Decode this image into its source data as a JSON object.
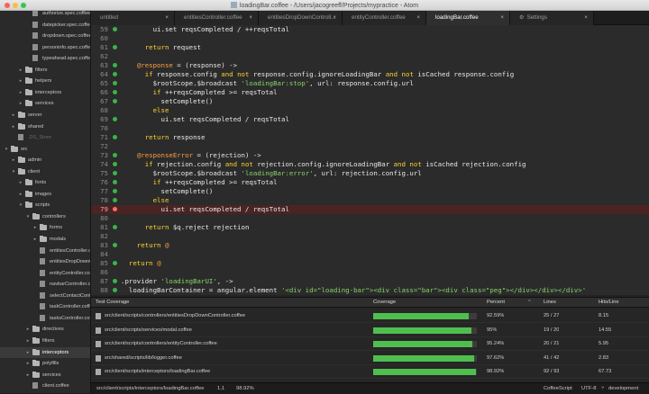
{
  "window": {
    "title": "loadingBar.coffee - /Users/jacogreeff/Projects/mypractice - Atom"
  },
  "tree": [
    {
      "label": "authorize.spec.coffee",
      "depth": 4,
      "kind": "file"
    },
    {
      "label": "datepicker.spec.coffee",
      "depth": 4,
      "kind": "file"
    },
    {
      "label": "dropdown.spec.coffee",
      "depth": 4,
      "kind": "file"
    },
    {
      "label": "personinfo.spec.coffee",
      "depth": 4,
      "kind": "file"
    },
    {
      "label": "typeahead.spec.coffee",
      "depth": 4,
      "kind": "file"
    },
    {
      "label": "filters",
      "depth": 3,
      "kind": "folder",
      "arrow": ">"
    },
    {
      "label": "helpers",
      "depth": 3,
      "kind": "folder",
      "arrow": ">"
    },
    {
      "label": "interceptors",
      "depth": 3,
      "kind": "folder",
      "arrow": ">"
    },
    {
      "label": "services",
      "depth": 3,
      "kind": "folder",
      "arrow": ">"
    },
    {
      "label": "server",
      "depth": 2,
      "kind": "folder",
      "arrow": ">"
    },
    {
      "label": "shared",
      "depth": 2,
      "kind": "folder",
      "arrow": ">"
    },
    {
      "label": ".DS_Store",
      "depth": 2,
      "kind": "file",
      "dim": true
    },
    {
      "label": "src",
      "depth": 1,
      "kind": "folder",
      "arrow": "v"
    },
    {
      "label": "admin",
      "depth": 2,
      "kind": "folder",
      "arrow": ">"
    },
    {
      "label": "client",
      "depth": 2,
      "kind": "folder",
      "arrow": "v"
    },
    {
      "label": "fonts",
      "depth": 3,
      "kind": "folder",
      "arrow": ">"
    },
    {
      "label": "images",
      "depth": 3,
      "kind": "folder",
      "arrow": ">"
    },
    {
      "label": "scripts",
      "depth": 3,
      "kind": "folder",
      "arrow": "v"
    },
    {
      "label": "controllers",
      "depth": 4,
      "kind": "folder",
      "arrow": "v"
    },
    {
      "label": "forms",
      "depth": 5,
      "kind": "folder",
      "arrow": ">"
    },
    {
      "label": "modals",
      "depth": 5,
      "kind": "folder",
      "arrow": ">"
    },
    {
      "label": "entitiesController.coffee",
      "depth": 5,
      "kind": "file"
    },
    {
      "label": "entitiesDropDownController.coffee",
      "depth": 5,
      "kind": "file"
    },
    {
      "label": "entityController.coffee",
      "depth": 5,
      "kind": "file"
    },
    {
      "label": "navbarController.coffee",
      "depth": 5,
      "kind": "file"
    },
    {
      "label": "selectContactController.coffee",
      "depth": 5,
      "kind": "file"
    },
    {
      "label": "taskController.coffee",
      "depth": 5,
      "kind": "file"
    },
    {
      "label": "tasksController.coffee",
      "depth": 5,
      "kind": "file"
    },
    {
      "label": "directives",
      "depth": 4,
      "kind": "folder",
      "arrow": ">"
    },
    {
      "label": "filters",
      "depth": 4,
      "kind": "folder",
      "arrow": ">"
    },
    {
      "label": "interceptors",
      "depth": 4,
      "kind": "folder",
      "arrow": ">",
      "selected": true
    },
    {
      "label": "polyfills",
      "depth": 4,
      "kind": "folder",
      "arrow": ">"
    },
    {
      "label": "services",
      "depth": 4,
      "kind": "folder",
      "arrow": ">"
    },
    {
      "label": "client.coffee",
      "depth": 4,
      "kind": "file"
    }
  ],
  "tabs": [
    {
      "label": "untitled"
    },
    {
      "label": "entitiesController.coffee"
    },
    {
      "label": "entitiesDropDownControll..."
    },
    {
      "label": "entityController.coffee"
    },
    {
      "label": "loadingBar.coffee",
      "active": true
    },
    {
      "label": "Settings",
      "icon": "gear-icon"
    }
  ],
  "editor": {
    "lines": [
      {
        "n": "59",
        "c": "        ui.set reqsCompleted / ++reqsTotal",
        "cov": true
      },
      {
        "n": "60",
        "c": ""
      },
      {
        "n": "61",
        "c": "      return request",
        "cov": true
      },
      {
        "n": "62",
        "c": ""
      },
      {
        "n": "63",
        "c": "    @response = (response) ->",
        "cov": true
      },
      {
        "n": "64",
        "c": "      if response.config and not response.config.ignoreLoadingBar and not isCached response.config",
        "cov": true
      },
      {
        "n": "65",
        "c": "        $rootScope.$broadcast 'loadingBar:stop', url: response.config.url",
        "cov": true
      },
      {
        "n": "66",
        "c": "        if ++reqsCompleted >= reqsTotal",
        "cov": true
      },
      {
        "n": "67",
        "c": "          setComplete()",
        "cov": true
      },
      {
        "n": "68",
        "c": "        else"
      },
      {
        "n": "69",
        "c": "          ui.set reqsCompleted / reqsTotal",
        "cov": true
      },
      {
        "n": "70",
        "c": ""
      },
      {
        "n": "71",
        "c": "      return response",
        "cov": true
      },
      {
        "n": "72",
        "c": ""
      },
      {
        "n": "73",
        "c": "    @responseError = (rejection) ->",
        "cov": true
      },
      {
        "n": "74",
        "c": "      if rejection.config and not rejection.config.ignoreLoadingBar and not isCached rejection.config",
        "cov": true
      },
      {
        "n": "75",
        "c": "        $rootScope.$broadcast 'loadingBar:error', url: rejection.config.url",
        "cov": true
      },
      {
        "n": "76",
        "c": "        if ++reqsCompleted >= reqsTotal",
        "cov": true
      },
      {
        "n": "77",
        "c": "          setComplete()",
        "cov": true
      },
      {
        "n": "78",
        "c": "        else",
        "cov": true
      },
      {
        "n": "79",
        "c": "          ui.set reqsCompleted / reqsTotal",
        "miss": true
      },
      {
        "n": "80",
        "c": ""
      },
      {
        "n": "81",
        "c": "      return $q.reject rejection",
        "cov": true
      },
      {
        "n": "82",
        "c": ""
      },
      {
        "n": "83",
        "c": "    return @",
        "cov": true
      },
      {
        "n": "84",
        "c": ""
      },
      {
        "n": "85",
        "c": "  return @",
        "cov": true
      },
      {
        "n": "86",
        "c": ""
      },
      {
        "n": "87",
        "c": ".provider 'loadingBarUI', ->",
        "cov": true
      },
      {
        "n": "88",
        "c": "  loadingBarContainer = angular.element '<div id=\"loading-bar\"><div class=\"bar\"><div class=\"peg\"></div></div></div>'",
        "cov": true
      }
    ]
  },
  "coverage": {
    "headers": {
      "file": "Test Coverage",
      "coverage": "Coverage",
      "percent": "Percent",
      "sort": "^",
      "lines": "Lines",
      "hits": "Hits/Line"
    },
    "rows": [
      {
        "file": "src/client/scripts/controllers/entitiesDropDownController.coffee",
        "pct": "92.59%",
        "frac": 0.9259,
        "lines": "25 / 27",
        "hits": "8.15"
      },
      {
        "file": "src/client/scripts/services/modal.coffee",
        "pct": "95%",
        "frac": 0.95,
        "lines": "19 / 20",
        "hits": "14.55"
      },
      {
        "file": "src/client/scripts/controllers/entityController.coffee",
        "pct": "95.24%",
        "frac": 0.9524,
        "lines": "20 / 21",
        "hits": "5.95"
      },
      {
        "file": "src/shared/scripts/lib/logger.coffee",
        "pct": "97.62%",
        "frac": 0.9762,
        "lines": "41 / 42",
        "hits": "2.83"
      },
      {
        "file": "src/client/scripts/interceptors/loadingBar.coffee",
        "pct": "98.92%",
        "frac": 0.9892,
        "lines": "92 / 93",
        "hits": "67.73"
      }
    ]
  },
  "status": {
    "path": "src/client/scripts/interceptors/loadingBar.coffee",
    "cursor": "1,1",
    "pct": "98.92%",
    "grammar": "CoffeeScript",
    "encoding": "UTF-8",
    "branch": "development"
  },
  "colors": {
    "keyword": "#ffd22e",
    "string": "#86d36a",
    "variable": "#ff9f43",
    "green": "#3bb34a",
    "miss": "#ff6b6b"
  }
}
